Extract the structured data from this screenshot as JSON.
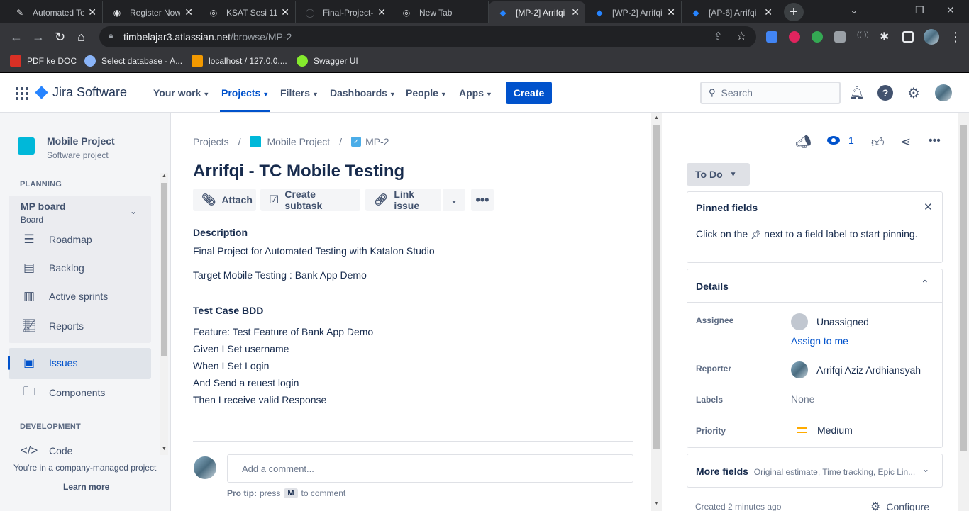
{
  "browser": {
    "tabs": [
      {
        "title": "Automated Te",
        "favicon": "katalon-icon"
      },
      {
        "title": "Register Now",
        "favicon": "github-icon"
      },
      {
        "title": "KSAT Sesi 11",
        "favicon": "chrome-icon"
      },
      {
        "title": "Final-Project-",
        "favicon": "github-icon"
      },
      {
        "title": "New Tab",
        "favicon": "chrome-icon"
      },
      {
        "title": "[MP-2] Arrifqi",
        "favicon": "jira-icon"
      },
      {
        "title": "[WP-2] Arrifqi",
        "favicon": "jira-icon"
      },
      {
        "title": "[AP-6] Arrifqi",
        "favicon": "jira-icon"
      }
    ],
    "url_host": "timbelajar3.atlassian.net",
    "url_path": "/browse/MP-2",
    "bookmarks": [
      {
        "label": "PDF ke DOC"
      },
      {
        "label": "Select database - A..."
      },
      {
        "label": "localhost / 127.0.0...."
      },
      {
        "label": "Swagger UI"
      }
    ]
  },
  "jira": {
    "logo": "Jira Software",
    "nav": [
      "Your work",
      "Projects",
      "Filters",
      "Dashboards",
      "People",
      "Apps"
    ],
    "create_label": "Create",
    "search_placeholder": "Search"
  },
  "sidebar": {
    "project_name": "Mobile Project",
    "project_type": "Software project",
    "planning_label": "PLANNING",
    "board_name": "MP board",
    "board_sub": "Board",
    "items": [
      "Roadmap",
      "Backlog",
      "Active sprints",
      "Reports"
    ],
    "issues_label": "Issues",
    "components_label": "Components",
    "development_label": "DEVELOPMENT",
    "code_label": "Code",
    "footer_text": "You're in a company-managed project",
    "learn_more": "Learn more"
  },
  "issue": {
    "breadcrumb": [
      "Projects",
      "Mobile Project",
      "MP-2"
    ],
    "title": "Arrifqi - TC Mobile Testing",
    "actions": [
      "Attach",
      "Create subtask",
      "Link issue"
    ],
    "description_label": "Description",
    "description": [
      "Final Project for Automated Testing with Katalon Studio",
      "Target Mobile Testing : Bank App Demo"
    ],
    "bdd_heading": "Test Case BDD",
    "bdd_lines": [
      "Feature: Test Feature of Bank App Demo",
      "Given I Set username",
      "When I Set Login",
      "And Send a reuest login",
      "Then I receive valid Response"
    ],
    "comment_placeholder": "Add a comment...",
    "protip_prefix": "Pro tip:",
    "protip_press": "press",
    "protip_key": "M",
    "protip_suffix": "to comment"
  },
  "details_panel": {
    "watch_count": "1",
    "status": "To Do",
    "pinned_title": "Pinned fields",
    "pinned_text_a": "Click on the",
    "pinned_text_b": "next to a field label to start pinning.",
    "details_title": "Details",
    "assignee_label": "Assignee",
    "assignee_value": "Unassigned",
    "assign_to_me": "Assign to me",
    "reporter_label": "Reporter",
    "reporter_value": "Arrifqi Aziz Ardhiansyah",
    "labels_label": "Labels",
    "labels_value": "None",
    "priority_label": "Priority",
    "priority_value": "Medium",
    "priority_color": "#ffab00",
    "more_fields_label": "More fields",
    "more_fields_hint": "Original estimate, Time tracking, Epic Lin...",
    "created_text": "Created 2 minutes ago",
    "configure_label": "Configure"
  }
}
